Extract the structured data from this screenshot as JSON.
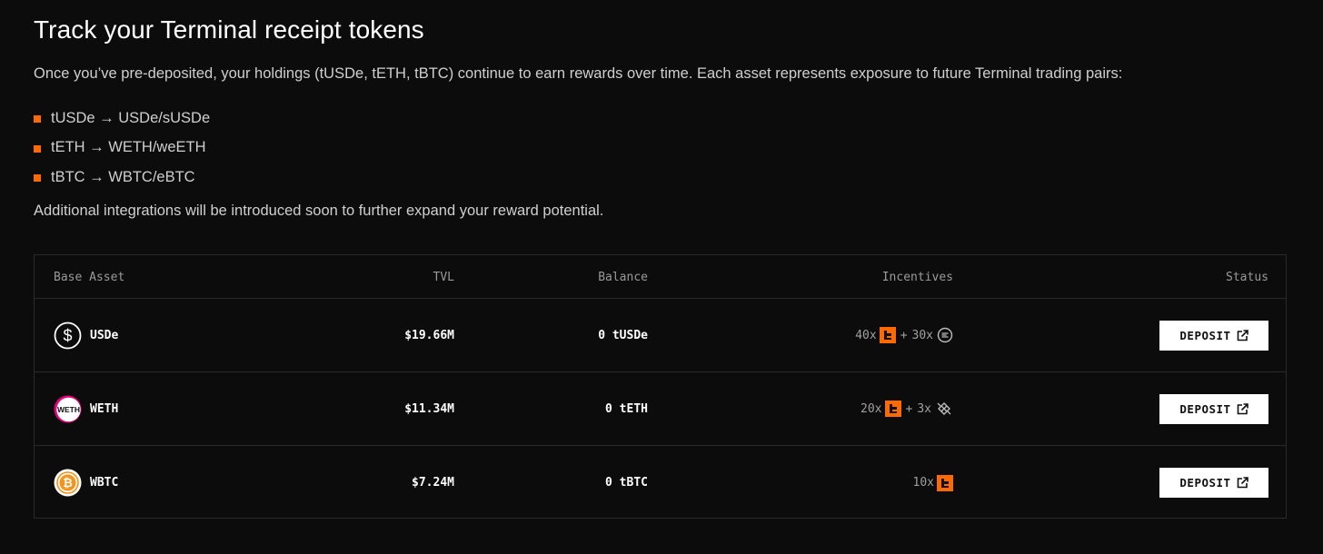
{
  "header": {
    "title": "Track your Terminal receipt tokens",
    "intro": "Once you’ve pre-deposited, your holdings (tUSDe, tETH, tBTC) continue to earn rewards over time. Each asset represents exposure to future Terminal trading pairs:",
    "pairs": [
      "tUSDe → USDe/sUSDe",
      "tETH → WETH/weETH",
      "tBTC → WBTC/eBTC"
    ],
    "outro": "Additional integrations will be introduced soon to further expand your reward potential."
  },
  "colors": {
    "accent": "#ff6a00",
    "background": "#0c0c0c",
    "border": "#2a2a2a"
  },
  "table": {
    "columns": {
      "asset": "Base Asset",
      "tvl": "TVL",
      "balance": "Balance",
      "incentives": "Incentives",
      "status": "Status"
    },
    "rows": [
      {
        "asset": "USDe",
        "icon": "usde-dollar-icon",
        "tvl": "$19.66M",
        "balance": "0 tUSDe",
        "terminal_mult": "40x",
        "plus": "+",
        "partner_mult": "30x",
        "partner_icon": "ethena-icon",
        "action": "DEPOSIT"
      },
      {
        "asset": "WETH",
        "icon": "weth-icon",
        "tvl": "$11.34M",
        "balance": "0 tETH",
        "terminal_mult": "20x",
        "plus": "+",
        "partner_mult": "3x",
        "partner_icon": "etherfi-icon",
        "action": "DEPOSIT"
      },
      {
        "asset": "WBTC",
        "icon": "wbtc-icon",
        "tvl": "$7.24M",
        "balance": "0 tBTC",
        "terminal_mult": "10x",
        "action": "DEPOSIT"
      }
    ]
  }
}
